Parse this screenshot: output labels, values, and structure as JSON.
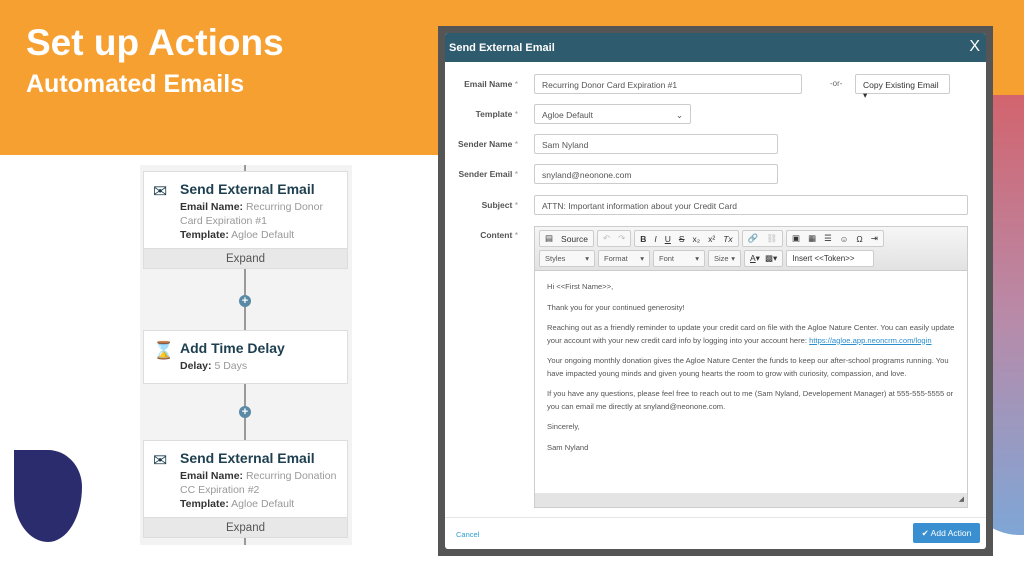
{
  "slide": {
    "title": "Set up Actions",
    "subtitle": "Automated Emails",
    "colors": {
      "orange": "#f7a032",
      "navy": "#2b2c6e",
      "teal": "#2f5b6e"
    }
  },
  "flow": [
    {
      "icon": "envelope-icon",
      "title": "Send External Email",
      "l1": "Email Name:",
      "v1": "Recurring Donor Card Expiration #1",
      "l2": "Template:",
      "v2": "Agloe Default",
      "expand": "Expand"
    },
    {
      "icon": "hourglass-icon",
      "title": "Add Time Delay",
      "l1": "Delay:",
      "v1": "5 Days"
    },
    {
      "icon": "envelope-icon",
      "title": "Send External Email",
      "l1": "Email Name:",
      "v1": "Recurring Donation CC Expiration #2",
      "l2": "Template:",
      "v2": "Agloe Default",
      "expand": "Expand"
    }
  ],
  "dialog": {
    "title": "Send External Email",
    "close": "X",
    "labels": {
      "email_name": "Email Name",
      "template": "Template",
      "sender_name": "Sender Name",
      "sender_email": "Sender Email",
      "subject": "Subject",
      "content": "Content",
      "req": "*"
    },
    "email_name": "Recurring Donor Card Expiration #1",
    "or": "-or-",
    "copy": "Copy Existing Email ▾",
    "template": "Agloe Default",
    "sender_name": "Sam Nyland",
    "sender_email": "snyland@neonone.com",
    "subject": "ATTN: Important information about your Credit Card",
    "toolbar": {
      "source": "Source",
      "styles": "Styles",
      "format": "Format",
      "font": "Font",
      "size": "Size",
      "token": "Insert <<Token>>"
    },
    "content": {
      "greeting": "Hi <<First Name>>,",
      "p1": "Thank you for your continued generosity!",
      "p2": "Reaching out as a friendly reminder to update your credit card on file with the Agloe Nature Center. You can easily update your account with your new credit card info by logging into your account here: ",
      "link": "https://agloe.app.neoncrm.com/login",
      "p3": "Your ongoing monthly donation gives the Agloe Nature Center the funds to keep our after-school programs running. You have impacted young minds and given young hearts the room to grow with curiosity, compassion, and love.",
      "p4": "If you have any questions, please feel free to reach out to me (Sam Nyland, Developement Manager) at 555-555-5555 or you can email me directly at snyland@neonone.com.",
      "p5": "Sincerely,",
      "p6": "Sam Nyland"
    },
    "cancel": "Cancel",
    "add": "✔ Add Action"
  }
}
